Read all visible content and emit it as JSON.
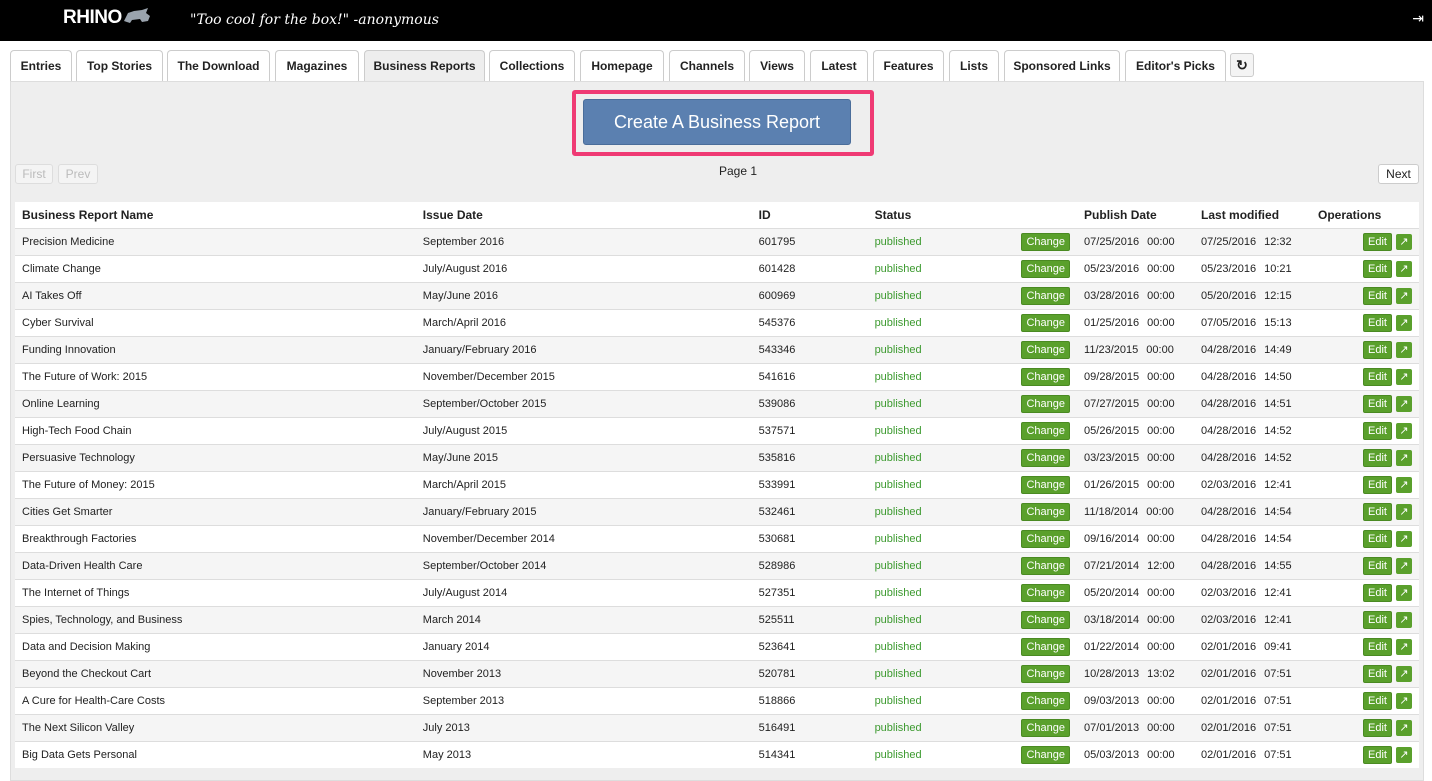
{
  "app": {
    "logo": "RHINO",
    "tagline": "\"Too cool for the box!\" -anonymous",
    "logout_icon": "logout-icon"
  },
  "tabs": [
    {
      "label": "Entries"
    },
    {
      "label": "Top Stories"
    },
    {
      "label": "The Download"
    },
    {
      "label": "Magazines"
    },
    {
      "label": "Business Reports",
      "active": true
    },
    {
      "label": "Collections"
    },
    {
      "label": "Homepage"
    },
    {
      "label": "Channels"
    },
    {
      "label": "Views"
    },
    {
      "label": "Latest"
    },
    {
      "label": "Features"
    },
    {
      "label": "Lists"
    },
    {
      "label": "Sponsored Links"
    },
    {
      "label": "Editor's Picks"
    }
  ],
  "refresh_icon": "refresh-icon",
  "create_button": "Create A Business Report",
  "pager": {
    "first": "First",
    "prev": "Prev",
    "page_label": "Page 1",
    "next": "Next"
  },
  "table": {
    "headers": [
      "Business Report Name",
      "Issue Date",
      "ID",
      "Status",
      "",
      "Publish Date",
      "Last modified",
      "Operations"
    ],
    "change_label": "Change",
    "edit_label": "Edit",
    "rows": [
      {
        "name": "Precision Medicine",
        "issue": "September 2016",
        "id": "601795",
        "status": "published",
        "pub_date": "07/25/2016",
        "pub_time": "00:00",
        "mod_date": "07/25/2016",
        "mod_time": "12:32"
      },
      {
        "name": "Climate Change",
        "issue": "July/August 2016",
        "id": "601428",
        "status": "published",
        "pub_date": "05/23/2016",
        "pub_time": "00:00",
        "mod_date": "05/23/2016",
        "mod_time": "10:21"
      },
      {
        "name": "AI Takes Off",
        "issue": "May/June 2016",
        "id": "600969",
        "status": "published",
        "pub_date": "03/28/2016",
        "pub_time": "00:00",
        "mod_date": "05/20/2016",
        "mod_time": "12:15"
      },
      {
        "name": "Cyber Survival",
        "issue": "March/April 2016",
        "id": "545376",
        "status": "published",
        "pub_date": "01/25/2016",
        "pub_time": "00:00",
        "mod_date": "07/05/2016",
        "mod_time": "15:13"
      },
      {
        "name": "Funding Innovation",
        "issue": "January/February 2016",
        "id": "543346",
        "status": "published",
        "pub_date": "11/23/2015",
        "pub_time": "00:00",
        "mod_date": "04/28/2016",
        "mod_time": "14:49"
      },
      {
        "name": "The Future of Work: 2015",
        "issue": "November/December 2015",
        "id": "541616",
        "status": "published",
        "pub_date": "09/28/2015",
        "pub_time": "00:00",
        "mod_date": "04/28/2016",
        "mod_time": "14:50"
      },
      {
        "name": "Online Learning",
        "issue": "September/October 2015",
        "id": "539086",
        "status": "published",
        "pub_date": "07/27/2015",
        "pub_time": "00:00",
        "mod_date": "04/28/2016",
        "mod_time": "14:51"
      },
      {
        "name": "High-Tech Food Chain",
        "issue": "July/August 2015",
        "id": "537571",
        "status": "published",
        "pub_date": "05/26/2015",
        "pub_time": "00:00",
        "mod_date": "04/28/2016",
        "mod_time": "14:52"
      },
      {
        "name": "Persuasive Technology",
        "issue": "May/June 2015",
        "id": "535816",
        "status": "published",
        "pub_date": "03/23/2015",
        "pub_time": "00:00",
        "mod_date": "04/28/2016",
        "mod_time": "14:52"
      },
      {
        "name": "The Future of Money: 2015",
        "issue": "March/April 2015",
        "id": "533991",
        "status": "published",
        "pub_date": "01/26/2015",
        "pub_time": "00:00",
        "mod_date": "02/03/2016",
        "mod_time": "12:41"
      },
      {
        "name": "Cities Get Smarter",
        "issue": "January/February 2015",
        "id": "532461",
        "status": "published",
        "pub_date": "11/18/2014",
        "pub_time": "00:00",
        "mod_date": "04/28/2016",
        "mod_time": "14:54"
      },
      {
        "name": "Breakthrough Factories",
        "issue": "November/December 2014",
        "id": "530681",
        "status": "published",
        "pub_date": "09/16/2014",
        "pub_time": "00:00",
        "mod_date": "04/28/2016",
        "mod_time": "14:54"
      },
      {
        "name": "Data-Driven Health Care",
        "issue": "September/October 2014",
        "id": "528986",
        "status": "published",
        "pub_date": "07/21/2014",
        "pub_time": "12:00",
        "mod_date": "04/28/2016",
        "mod_time": "14:55"
      },
      {
        "name": "The Internet of Things",
        "issue": "July/August 2014",
        "id": "527351",
        "status": "published",
        "pub_date": "05/20/2014",
        "pub_time": "00:00",
        "mod_date": "02/03/2016",
        "mod_time": "12:41"
      },
      {
        "name": "Spies, Technology, and Business",
        "issue": "March 2014",
        "id": "525511",
        "status": "published",
        "pub_date": "03/18/2014",
        "pub_time": "00:00",
        "mod_date": "02/03/2016",
        "mod_time": "12:41"
      },
      {
        "name": "Data and Decision Making",
        "issue": "January 2014",
        "id": "523641",
        "status": "published",
        "pub_date": "01/22/2014",
        "pub_time": "00:00",
        "mod_date": "02/01/2016",
        "mod_time": "09:41"
      },
      {
        "name": "Beyond the Checkout Cart",
        "issue": "November 2013",
        "id": "520781",
        "status": "published",
        "pub_date": "10/28/2013",
        "pub_time": "13:02",
        "mod_date": "02/01/2016",
        "mod_time": "07:51"
      },
      {
        "name": "A Cure for Health-Care Costs",
        "issue": "September 2013",
        "id": "518866",
        "status": "published",
        "pub_date": "09/03/2013",
        "pub_time": "00:00",
        "mod_date": "02/01/2016",
        "mod_time": "07:51"
      },
      {
        "name": "The Next Silicon Valley",
        "issue": "July 2013",
        "id": "516491",
        "status": "published",
        "pub_date": "07/01/2013",
        "pub_time": "00:00",
        "mod_date": "02/01/2016",
        "mod_time": "07:51"
      },
      {
        "name": "Big Data Gets Personal",
        "issue": "May 2013",
        "id": "514341",
        "status": "published",
        "pub_date": "05/03/2013",
        "pub_time": "00:00",
        "mod_date": "02/01/2016",
        "mod_time": "07:51"
      }
    ]
  }
}
